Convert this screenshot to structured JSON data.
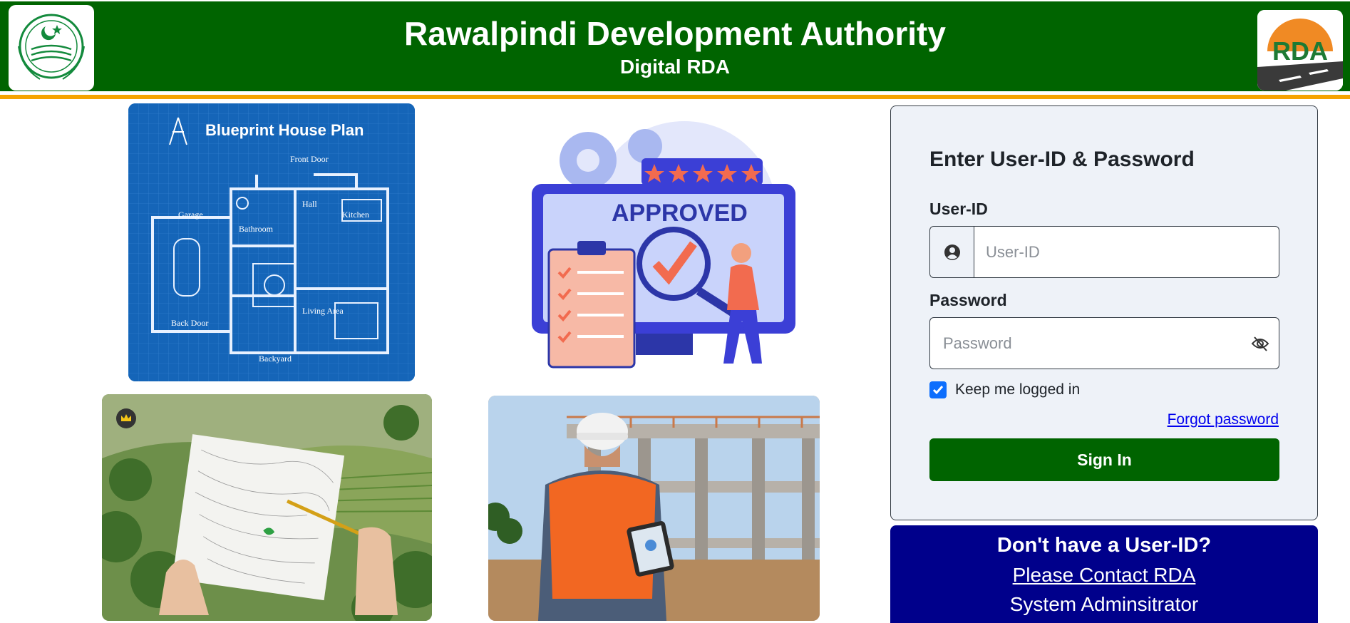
{
  "header": {
    "title": "Rawalpindi Development Authority",
    "subtitle": "Digital RDA",
    "right_logo_text": "RDA",
    "bg_color": "#006400",
    "stripe_color": "#f5a300"
  },
  "gallery": {
    "blueprint_title": "Blueprint House Plan",
    "blueprint_labels": [
      "Front Door",
      "Garage",
      "Hall",
      "Kitchen",
      "Bathroom",
      "Living Area",
      "Back Door",
      "Backyard"
    ],
    "approved_text": "APPROVED"
  },
  "login": {
    "heading": "Enter User-ID & Password",
    "userid_label": "User-ID",
    "userid_placeholder": "User-ID",
    "password_label": "Password",
    "password_placeholder": "Password",
    "keep_logged_in_label": "Keep me logged in",
    "keep_logged_in_checked": true,
    "forgot_password": "Forgot password",
    "signin_label": "Sign In"
  },
  "contact": {
    "title": "Don't have a User-ID?",
    "link": "Please Contact RDA",
    "sub": "System Adminsitrator"
  },
  "icons": {
    "user": "user-circle-icon",
    "eye": "eye-slash-icon",
    "check": "checkmark-icon",
    "crown": "crown-icon"
  },
  "colors": {
    "primary_green": "#006400",
    "accent_orange": "#f5a300",
    "contact_blue": "#00008b",
    "checkbox_blue": "#0d6efd"
  }
}
